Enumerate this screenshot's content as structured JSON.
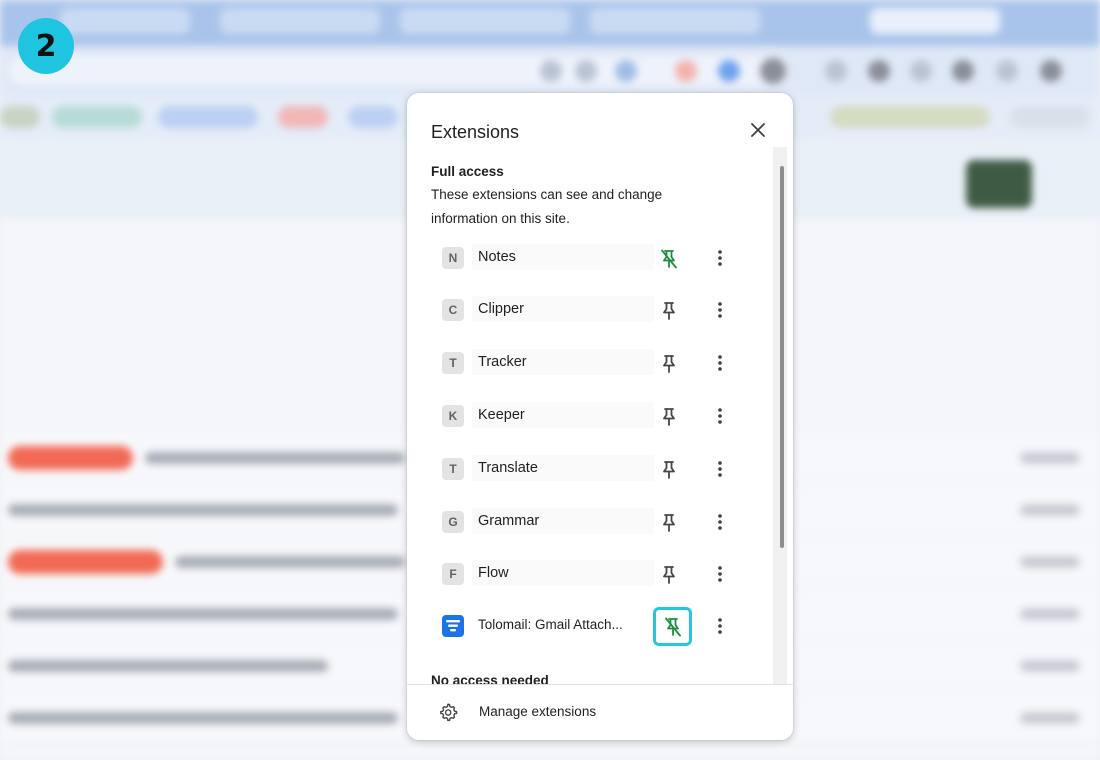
{
  "step": {
    "number": "2"
  },
  "popup": {
    "title": "Extensions",
    "full_access": {
      "heading": "Full access",
      "description": "These extensions can see and change information on this site."
    },
    "extensions": [
      {
        "letter": "N",
        "name": "Notes",
        "pinned": true
      },
      {
        "letter": "C",
        "name": "Clipper",
        "pinned": false
      },
      {
        "letter": "T",
        "name": "Tracker",
        "pinned": false
      },
      {
        "letter": "K",
        "name": "Keeper",
        "pinned": false
      },
      {
        "letter": "T",
        "name": "Translate",
        "pinned": false
      },
      {
        "letter": "G",
        "name": "Grammar",
        "pinned": false
      },
      {
        "letter": "F",
        "name": "Flow",
        "pinned": false
      },
      {
        "letter": "",
        "name": "Tolomail: Gmail Attach...",
        "pinned": true,
        "highlighted": true
      }
    ],
    "no_access": {
      "heading": "No access needed"
    },
    "manage_label": "Manage extensions"
  },
  "colors": {
    "pinned_icon": "#1e8e3e",
    "unpinned_icon": "#444746",
    "highlight_border": "#28c6dd",
    "step_badge": "#1fc4e0"
  }
}
